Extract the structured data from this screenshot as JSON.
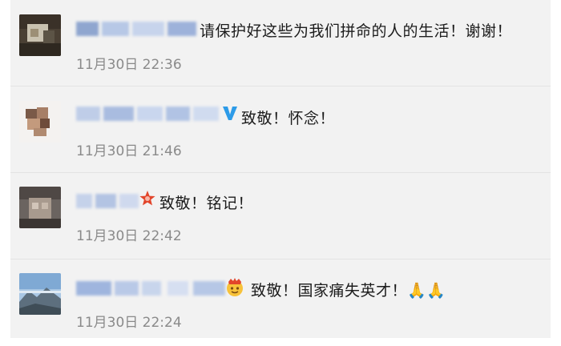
{
  "comments": [
    {
      "text": "请保护好这些为我们拼命的人的生活！谢谢！",
      "time": "11月30日 22:36"
    },
    {
      "text": "致敬！怀念！",
      "time": "11月30日 21:46"
    },
    {
      "text": "致敬！铭记！",
      "time": "11月30日 22:42"
    },
    {
      "text": "致敬！国家痛失英才！🙏🙏",
      "time": "11月30日 22:24"
    }
  ],
  "colors": {
    "panel_background": "#f2f2f2",
    "text": "#1c1c1c",
    "timestamp": "#8a8a8a",
    "verified_blue": "#2d9be8",
    "star_red": "#e2452b"
  },
  "icons": {
    "verified": "verified-v-icon",
    "star_badge": "star-badge-icon",
    "crown_emoji": "crown-face-emoji-icon",
    "pray_emoji": "folded-hands-icon"
  }
}
